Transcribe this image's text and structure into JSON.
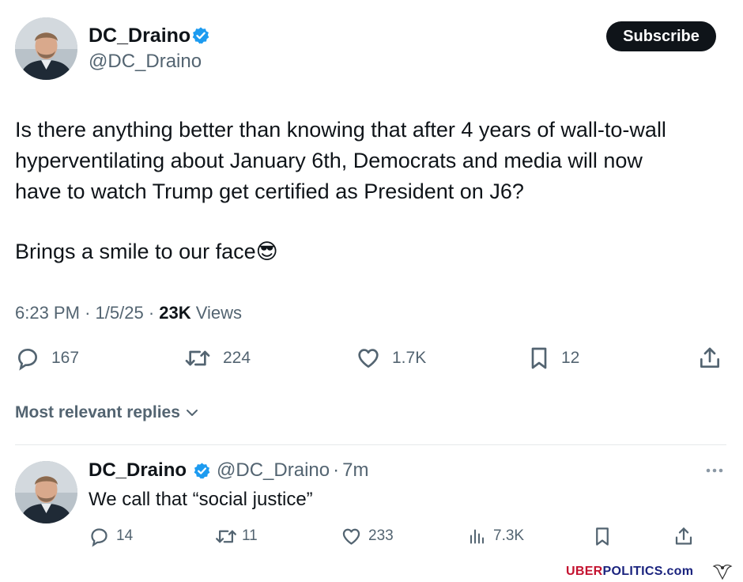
{
  "tweet": {
    "author_name": "DC_Draino",
    "author_handle": "@DC_Draino",
    "subscribe_label": "Subscribe",
    "text_line1": "Is there anything better than knowing that after 4 years of wall-to-wall",
    "text_line2": "hyperventilating about January 6th, Democrats and media will now",
    "text_line3": "have to watch Trump get certified as President on J6?",
    "text_line4": "Brings a smile to our face",
    "emoji": "😎",
    "time": "6:23 PM",
    "date": "1/5/25",
    "views_count": "23K",
    "views_label": "Views",
    "sep": "·",
    "stats": {
      "replies": "167",
      "reposts": "224",
      "likes": "1.7K",
      "bookmarks": "12"
    }
  },
  "replies_filter": {
    "label": "Most relevant replies"
  },
  "reply": {
    "author_name": "DC_Draino",
    "author_handle": "@DC_Draino",
    "age": "7m",
    "sep": "·",
    "text": "We call that “social justice”",
    "stats": {
      "replies": "14",
      "reposts": "11",
      "likes": "233",
      "views": "7.3K"
    }
  },
  "watermark": {
    "red": "UBER",
    "blue": "POLITICS",
    "suffix": ".com"
  },
  "colors": {
    "text": "#0f1419",
    "secondary": "#536471",
    "verified": "#1d9bf0",
    "divider": "#e6e9eb",
    "watermark_red": "#c4122f",
    "watermark_blue": "#1a237e"
  },
  "icons": {
    "verified": "verified-badge-icon",
    "reply": "reply-icon",
    "repost": "repost-icon",
    "like": "heart-icon",
    "bookmark": "bookmark-icon",
    "share": "share-icon",
    "views": "views-icon",
    "more": "more-icon",
    "chevron": "chevron-down-icon"
  }
}
